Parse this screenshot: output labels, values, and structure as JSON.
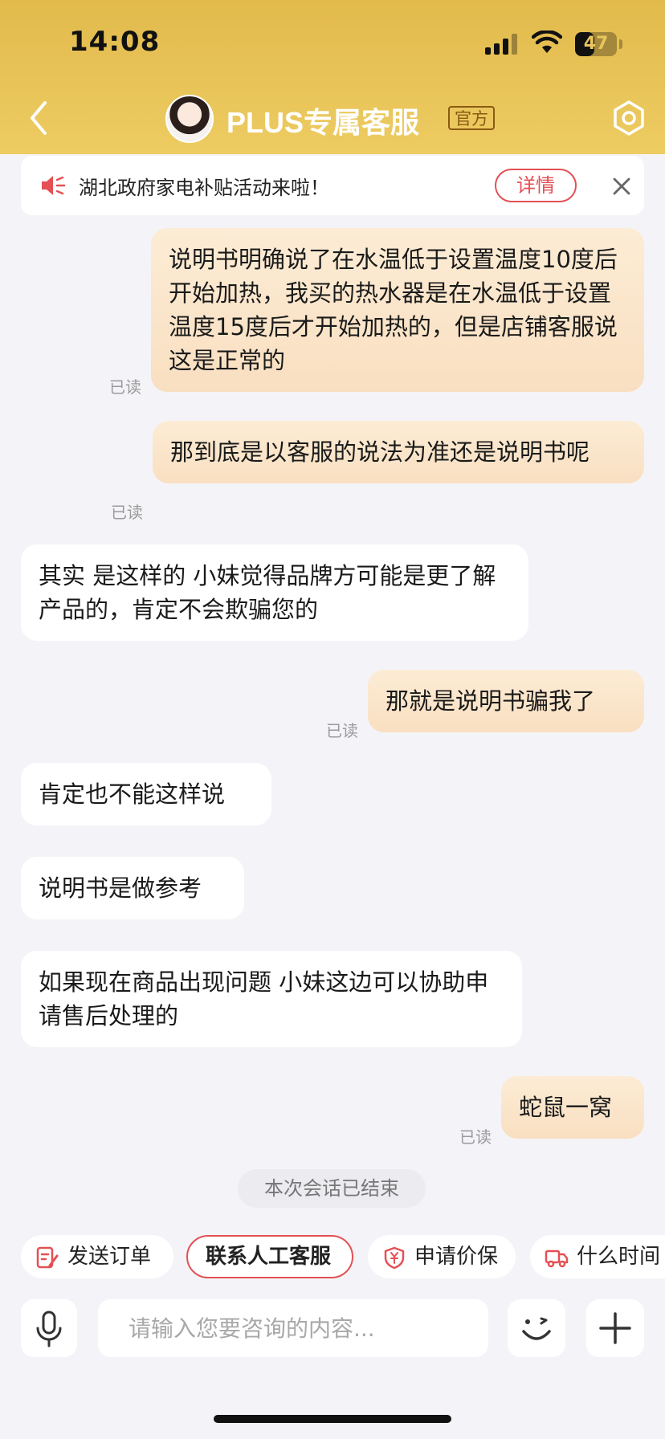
{
  "status_bar": {
    "time": "14:08",
    "battery": "47",
    "battery_level_percent": 47
  },
  "header": {
    "title": "PLUS专属客服",
    "badge": "官方"
  },
  "notice": {
    "text": "湖北政府家电补贴活动来啦！",
    "detail_label": "详情"
  },
  "messages": [
    {
      "side": "out",
      "text": "说明书明确说了在水温低于设置温度10度后开始加热，我买的热水器是在水温低于设置温度15度后才开始加热的，但是店铺客服说这是正常的",
      "read": "已读"
    },
    {
      "side": "out",
      "text": "那到底是以客服的说法为准还是说明书呢",
      "read": "已读"
    },
    {
      "side": "in",
      "text": "其实 是这样的 小妹觉得品牌方可能是更了解产品的，肯定不会欺骗您的"
    },
    {
      "side": "out",
      "text": "那就是说明书骗我了",
      "read": "已读"
    },
    {
      "side": "in",
      "text": "肯定也不能这样说"
    },
    {
      "side": "in",
      "text": "说明书是做参考"
    },
    {
      "side": "in",
      "text": "如果现在商品出现问题 小妹这边可以协助申请售后处理的"
    },
    {
      "side": "out",
      "text": "蛇鼠一窝",
      "read": "已读"
    }
  ],
  "session_end": "本次会话已结束",
  "quick_actions": [
    {
      "label": "发送订单",
      "icon": "order-edit-icon"
    },
    {
      "label": "联系人工客服",
      "icon": ""
    },
    {
      "label": "申请价保",
      "icon": "price-shield-icon"
    },
    {
      "label": "什么时间",
      "icon": "delivery-truck-icon"
    }
  ],
  "input": {
    "placeholder": "请输入您要咨询的内容..."
  },
  "colors": {
    "header": "#e2ba4c",
    "accent_red": "#e45055",
    "bubble_out": "#fbe4c8",
    "background": "#f4f4f8"
  }
}
